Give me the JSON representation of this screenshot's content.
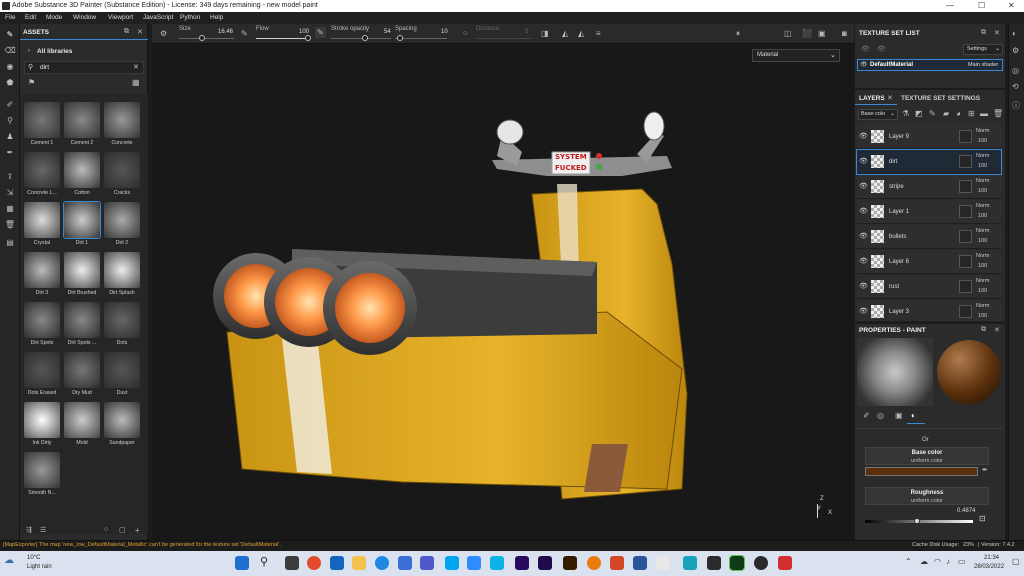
{
  "window": {
    "title": "Adobe Substance 3D Painter (Substance Edition) - License: 349 days remaining - new model paint"
  },
  "menu": [
    "File",
    "Edit",
    "Mode",
    "Window",
    "Viewport",
    "JavaScript",
    "Python",
    "Help"
  ],
  "toolbar": {
    "size_label": "Size",
    "size_value": "16.46",
    "flow_label": "Flow",
    "flow_value": "100",
    "stroke_label": "Stroke opacity",
    "stroke_value": "54",
    "spacing_label": "Spacing",
    "spacing_value": "10",
    "distance_label": "Distance",
    "distance_value": "5"
  },
  "assets": {
    "title": "ASSETS",
    "library": "All libraries",
    "search": "dirt",
    "items": [
      "Cement 1",
      "Cement 2",
      "Concrete",
      "Concrete L...",
      "Cotton",
      "Cracks",
      "Crystal",
      "Dirt 1",
      "Dirt 2",
      "Dirt 3",
      "Dirt Brushed",
      "Dirt Splash",
      "Dirt Spots",
      "Dirt Spots ...",
      "Dots",
      "Dots Erased",
      "Dry Mud",
      "Dust",
      "Ink Dirty",
      "Mold",
      "Sandpaper",
      "Smooth N..."
    ],
    "selected": "Dirt 1"
  },
  "viewport": {
    "mode_select": "Material",
    "sign_line1": "SYSTEM",
    "sign_line2": "FUCKED",
    "axis_z": "Z",
    "axis_y": "Y",
    "axis_x": "X"
  },
  "texture_set_list": {
    "title": "TEXTURE SET LIST",
    "settings": "Settings",
    "set_name": "DefaultMaterial",
    "shader": "Main shader"
  },
  "layers": {
    "tab_layers": "LAYERS",
    "tab_tss": "TEXTURE SET SETTINGS",
    "channel": "Base colo",
    "rows": [
      {
        "name": "Layer 9",
        "blend": "Norm",
        "opacity": "100"
      },
      {
        "name": "dirt",
        "blend": "Norm",
        "opacity": "100"
      },
      {
        "name": "stripe",
        "blend": "Norm",
        "opacity": "100"
      },
      {
        "name": "Layer 1",
        "blend": "Norm",
        "opacity": "100"
      },
      {
        "name": "bullets",
        "blend": "Norm",
        "opacity": "100"
      },
      {
        "name": "Layer 6",
        "blend": "Norm",
        "opacity": "100"
      },
      {
        "name": "rust",
        "blend": "Norm",
        "opacity": "100"
      },
      {
        "name": "Layer 3",
        "blend": "Norm",
        "opacity": "100"
      }
    ]
  },
  "properties": {
    "title": "PROPERTIES - PAINT",
    "or": "Or",
    "base_color": "Base color",
    "base_sub": "uniform color",
    "base_hex": "#5a300c",
    "roughness": "Roughness",
    "rough_sub": "uniform color",
    "rough_value": "0.4874"
  },
  "status": {
    "message": "[MapExporter] The map 'new_low_DefaultMaterial_Metallic' can't be generated for the texture set 'DefaultMaterial'.",
    "cache": "Cache Disk Usage:",
    "cache_pct": "23%",
    "version": "| Version: 7.4.2"
  },
  "taskbar": {
    "temp": "10°C",
    "weather": "Light rain",
    "time": "21:34",
    "date": "28/03/2022"
  }
}
